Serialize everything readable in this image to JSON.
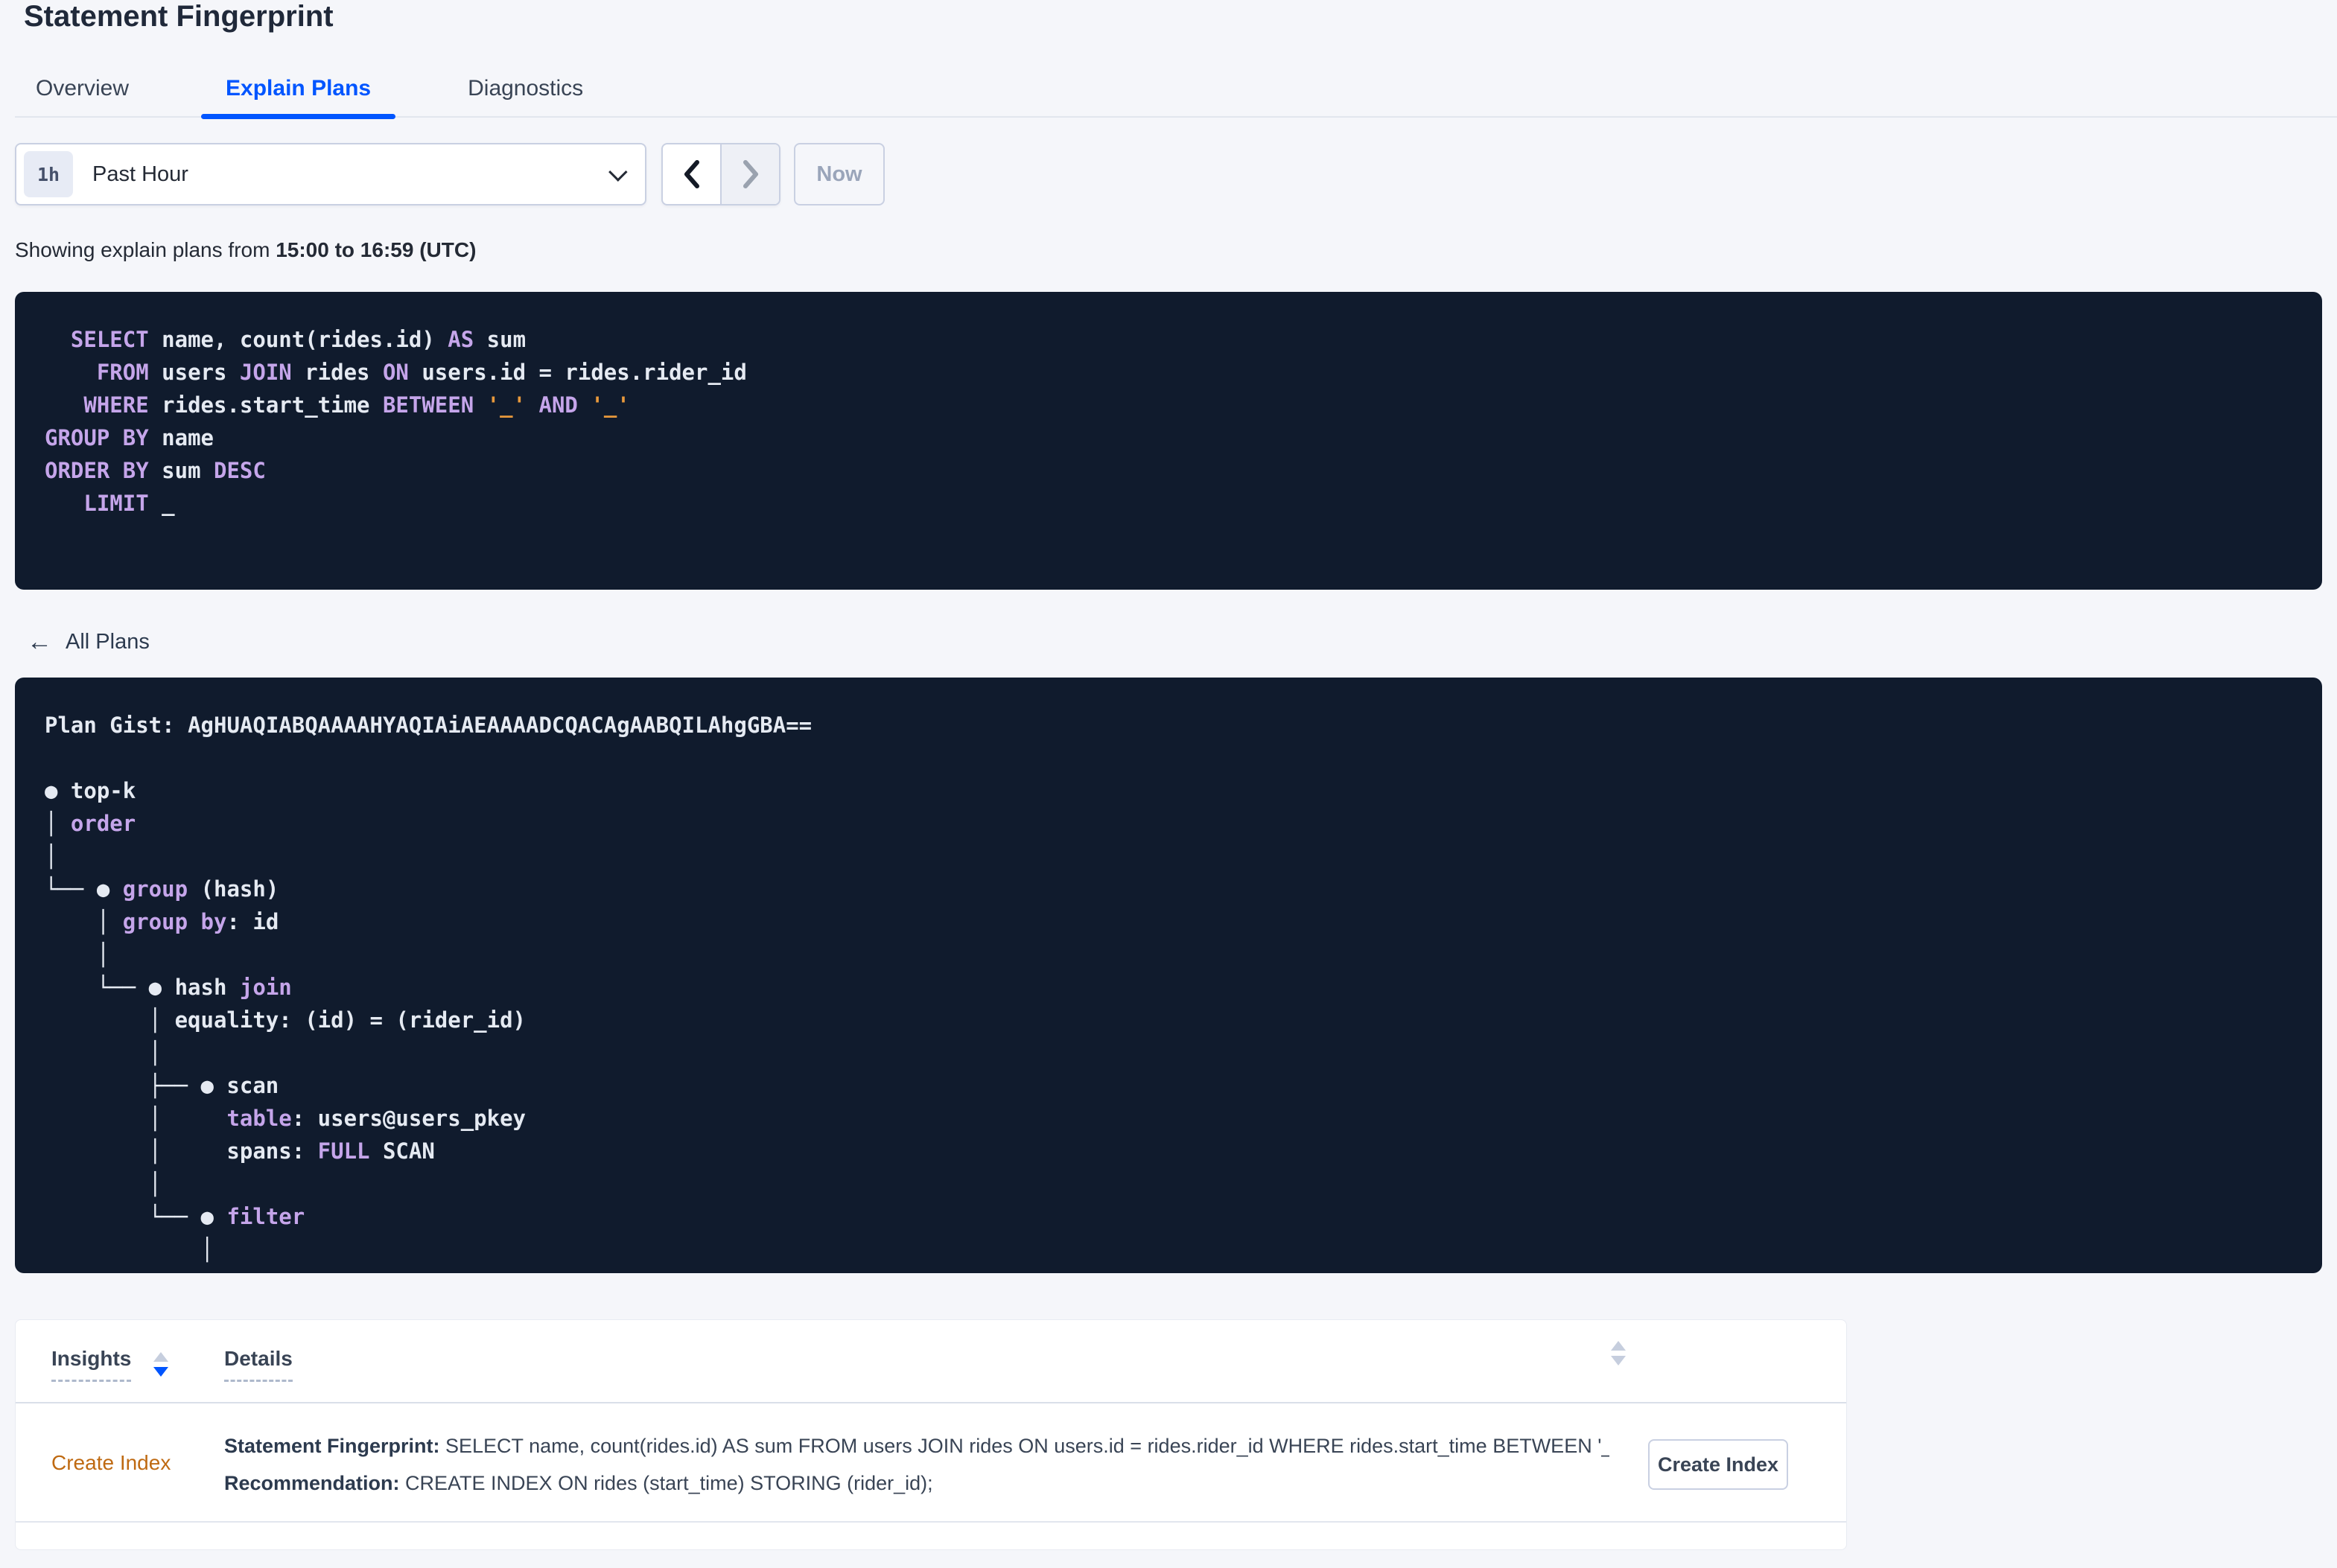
{
  "page": {
    "title": "Statement Fingerprint"
  },
  "tabs": [
    {
      "label": "Overview"
    },
    {
      "label": "Explain Plans"
    },
    {
      "label": "Diagnostics"
    }
  ],
  "toolbar": {
    "range_badge": "1h",
    "range_label": "Past Hour",
    "now_label": "Now"
  },
  "subheader": {
    "prefix": "Showing explain plans from ",
    "range_bold": "15:00 to 16:59 (UTC)"
  },
  "sql_box": {
    "lines": [
      [
        {
          "c": "k",
          "t": "  SELECT"
        },
        {
          "c": "p",
          "t": " name, count(rides.id) "
        },
        {
          "c": "k",
          "t": "AS"
        },
        {
          "c": "p",
          "t": " sum"
        }
      ],
      [
        {
          "c": "k",
          "t": "    FROM"
        },
        {
          "c": "p",
          "t": " users "
        },
        {
          "c": "k",
          "t": "JOIN"
        },
        {
          "c": "p",
          "t": " rides "
        },
        {
          "c": "k",
          "t": "ON"
        },
        {
          "c": "p",
          "t": " users.id = rides.rider_id"
        }
      ],
      [
        {
          "c": "k",
          "t": "   WHERE"
        },
        {
          "c": "p",
          "t": " rides.start_time "
        },
        {
          "c": "k",
          "t": "BETWEEN"
        },
        {
          "c": "p",
          "t": " "
        },
        {
          "c": "o",
          "t": "'_'"
        },
        {
          "c": "p",
          "t": " "
        },
        {
          "c": "k",
          "t": "AND"
        },
        {
          "c": "p",
          "t": " "
        },
        {
          "c": "o",
          "t": "'_'"
        }
      ],
      [
        {
          "c": "k",
          "t": "GROUP BY"
        },
        {
          "c": "p",
          "t": " name"
        }
      ],
      [
        {
          "c": "k",
          "t": "ORDER BY"
        },
        {
          "c": "p",
          "t": " sum "
        },
        {
          "c": "k",
          "t": "DESC"
        }
      ],
      [
        {
          "c": "k",
          "t": "   LIMIT"
        },
        {
          "c": "p",
          "t": " _"
        }
      ]
    ]
  },
  "back_link": {
    "label": "All Plans"
  },
  "plan_box": {
    "gist_label": "Plan Gist: ",
    "gist_value": "AgHUAQIABQAAAAHYAQIAiAEAAAADCQACAgAABQILAhgGBA==",
    "tree_lines": [
      [
        {
          "c": "p",
          "t": "● top-k"
        }
      ],
      [
        {
          "c": "p",
          "t": "│ "
        },
        {
          "c": "k",
          "t": "order"
        }
      ],
      [
        {
          "c": "p",
          "t": "│"
        }
      ],
      [
        {
          "c": "p",
          "t": "└── ● "
        },
        {
          "c": "k",
          "t": "group"
        },
        {
          "c": "p",
          "t": " (hash)"
        }
      ],
      [
        {
          "c": "p",
          "t": "    │ "
        },
        {
          "c": "k",
          "t": "group by"
        },
        {
          "c": "p",
          "t": ": id"
        }
      ],
      [
        {
          "c": "p",
          "t": "    │"
        }
      ],
      [
        {
          "c": "p",
          "t": "    └── ● hash "
        },
        {
          "c": "k",
          "t": "join"
        }
      ],
      [
        {
          "c": "p",
          "t": "        │ equality: (id) = (rider_id)"
        }
      ],
      [
        {
          "c": "p",
          "t": "        │"
        }
      ],
      [
        {
          "c": "p",
          "t": "        ├── ● scan"
        }
      ],
      [
        {
          "c": "p",
          "t": "        │     "
        },
        {
          "c": "k",
          "t": "table"
        },
        {
          "c": "p",
          "t": ": users@users_pkey"
        }
      ],
      [
        {
          "c": "p",
          "t": "        │     spans: "
        },
        {
          "c": "k",
          "t": "FULL"
        },
        {
          "c": "p",
          "t": " SCAN"
        }
      ],
      [
        {
          "c": "p",
          "t": "        │"
        }
      ],
      [
        {
          "c": "p",
          "t": "        └── ● "
        },
        {
          "c": "k",
          "t": "filter"
        }
      ],
      [
        {
          "c": "p",
          "t": "            │"
        }
      ]
    ]
  },
  "insights": {
    "columns": [
      {
        "label": "Insights"
      },
      {
        "label": "Details"
      }
    ],
    "rows": [
      {
        "insight_link": "Create Index",
        "fingerprint_label": "Statement Fingerprint:",
        "fingerprint_text": " SELECT name, count(rides.id) AS sum FROM users JOIN rides ON users.id = rides.rider_id WHERE rides.start_time BETWEEN '_…",
        "recommendation_label": "Recommendation:",
        "recommendation_text": " CREATE INDEX ON rides (start_time) STORING (rider_id);",
        "action_label": "Create Index"
      }
    ]
  },
  "colors": {
    "accent_blue": "#0055ff",
    "keyword_purple": "#c5a5ea",
    "literal_orange": "#e8993c",
    "insight_link_amber": "#bf6a12",
    "code_background": "#101b2d"
  }
}
